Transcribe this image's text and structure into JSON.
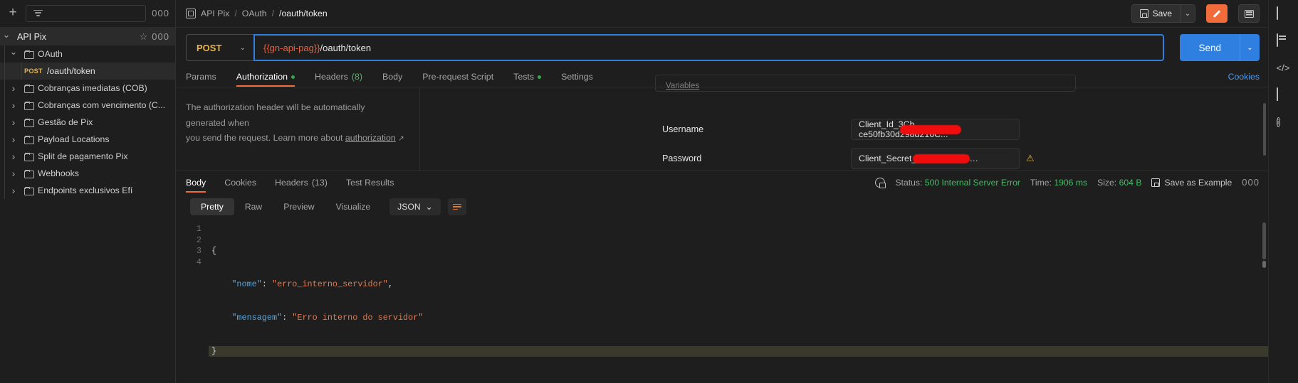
{
  "sidebar": {
    "add_label": "+",
    "filter_icon": "filter-icon",
    "more_icon": "000",
    "collection": {
      "name": "API Pix",
      "star_icon": "☆",
      "more_icon": "000"
    },
    "items": [
      {
        "label": "OAuth",
        "type": "folder",
        "depth": 1,
        "expanded": true
      },
      {
        "label": "/oauth/token",
        "type": "request",
        "method": "POST",
        "depth": 2,
        "selected": true
      },
      {
        "label": "Cobranças imediatas (COB)",
        "type": "folder",
        "depth": 1,
        "expanded": false
      },
      {
        "label": "Cobranças com vencimento (C...",
        "type": "folder",
        "depth": 1,
        "expanded": false
      },
      {
        "label": "Gestão de Pix",
        "type": "folder",
        "depth": 1,
        "expanded": false
      },
      {
        "label": "Payload Locations",
        "type": "folder",
        "depth": 1,
        "expanded": false
      },
      {
        "label": "Split de pagamento Pix",
        "type": "folder",
        "depth": 1,
        "expanded": false
      },
      {
        "label": "Webhooks",
        "type": "folder",
        "depth": 1,
        "expanded": false
      },
      {
        "label": "Endpoints exclusivos Efí",
        "type": "folder",
        "depth": 1,
        "expanded": false
      }
    ]
  },
  "header": {
    "breadcrumb": {
      "collection": "API Pix",
      "folder": "OAuth",
      "request": "/oauth/token",
      "separator": "/"
    },
    "save_label": "Save",
    "save_caret": "⌄",
    "edit_icon": "pencil-icon",
    "layout_icon": "panel-layout-icon"
  },
  "request": {
    "method": "POST",
    "method_caret": "⌄",
    "url_variable": "{{gn-api-pag}}",
    "url_path": "/oauth/token",
    "send_label": "Send",
    "send_caret": "⌄",
    "tabs": [
      {
        "label": "Params",
        "active": false,
        "dot": false
      },
      {
        "label": "Authorization",
        "active": true,
        "dot": true
      },
      {
        "label": "Headers",
        "active": false,
        "count": "(8)"
      },
      {
        "label": "Body",
        "active": false,
        "dot": false
      },
      {
        "label": "Pre-request Script",
        "active": false,
        "dot": false
      },
      {
        "label": "Tests",
        "active": false,
        "dot": true
      },
      {
        "label": "Settings",
        "active": false,
        "dot": false
      }
    ],
    "cookies_label": "Cookies"
  },
  "authorization": {
    "note_line1": "The authorization header will be automatically generated when",
    "note_line2_pre": "you send the request. Learn more about ",
    "note_link": "authorization",
    "note_arrow": "↗",
    "variables_label": "Variables",
    "fields": [
      {
        "label": "Username",
        "value": "Client_Id_3Cb…ce50fb30d298d216C...",
        "warning": false
      },
      {
        "label": "Password",
        "value": "Client_Secret_ae…d893394…",
        "warning": true,
        "warning_icon": "⚠"
      }
    ]
  },
  "response": {
    "tabs": [
      {
        "label": "Body",
        "active": true
      },
      {
        "label": "Cookies",
        "active": false
      },
      {
        "label": "Headers",
        "active": false,
        "count": "(13)"
      },
      {
        "label": "Test Results",
        "active": false
      }
    ],
    "meta": {
      "status_key": "Status:",
      "status_value": "500 Internal Server Error",
      "time_key": "Time:",
      "time_value": "1906 ms",
      "size_key": "Size:",
      "size_value": "604 B",
      "save_example_label": "Save as Example",
      "more_icon": "000",
      "globe_icon": "globe-lock-icon"
    },
    "view_modes": [
      {
        "label": "Pretty",
        "active": true
      },
      {
        "label": "Raw",
        "active": false
      },
      {
        "label": "Preview",
        "active": false
      },
      {
        "label": "Visualize",
        "active": false
      }
    ],
    "format": "JSON",
    "format_caret": "⌄",
    "wrap_icon": "wrap-lines-icon",
    "copy_icon": "copy-icon",
    "search_icon": "search-icon",
    "body_lines": [
      {
        "num": "1",
        "segments": [
          {
            "t": "{",
            "c": "brace"
          }
        ],
        "highlight": false
      },
      {
        "num": "2",
        "segments": [
          {
            "t": "    ",
            "c": "punc"
          },
          {
            "t": "\"nome\"",
            "c": "key"
          },
          {
            "t": ": ",
            "c": "punc"
          },
          {
            "t": "\"erro_interno_servidor\"",
            "c": "str"
          },
          {
            "t": ",",
            "c": "punc"
          }
        ],
        "highlight": false
      },
      {
        "num": "3",
        "segments": [
          {
            "t": "    ",
            "c": "punc"
          },
          {
            "t": "\"mensagem\"",
            "c": "key"
          },
          {
            "t": ": ",
            "c": "punc"
          },
          {
            "t": "\"Erro interno do servidor\"",
            "c": "str"
          }
        ],
        "highlight": false
      },
      {
        "num": "4",
        "segments": [
          {
            "t": "}",
            "c": "brace"
          }
        ],
        "highlight": true
      }
    ]
  },
  "rail": {
    "items": [
      {
        "icon": "document-icon"
      },
      {
        "icon": "mock-server-icon"
      },
      {
        "icon": "code-snippet-icon",
        "glyph": "</>"
      },
      {
        "icon": "lightbulb-icon"
      },
      {
        "icon": "info-icon",
        "glyph": "i"
      }
    ]
  },
  "colors": {
    "accent_orange": "#f26b3a",
    "send_blue": "#2f7fe0",
    "method_yellow": "#e6b34d",
    "status_green": "#3fbf63",
    "variable_red": "#e8603c",
    "redaction_red": "#f10d0d"
  }
}
